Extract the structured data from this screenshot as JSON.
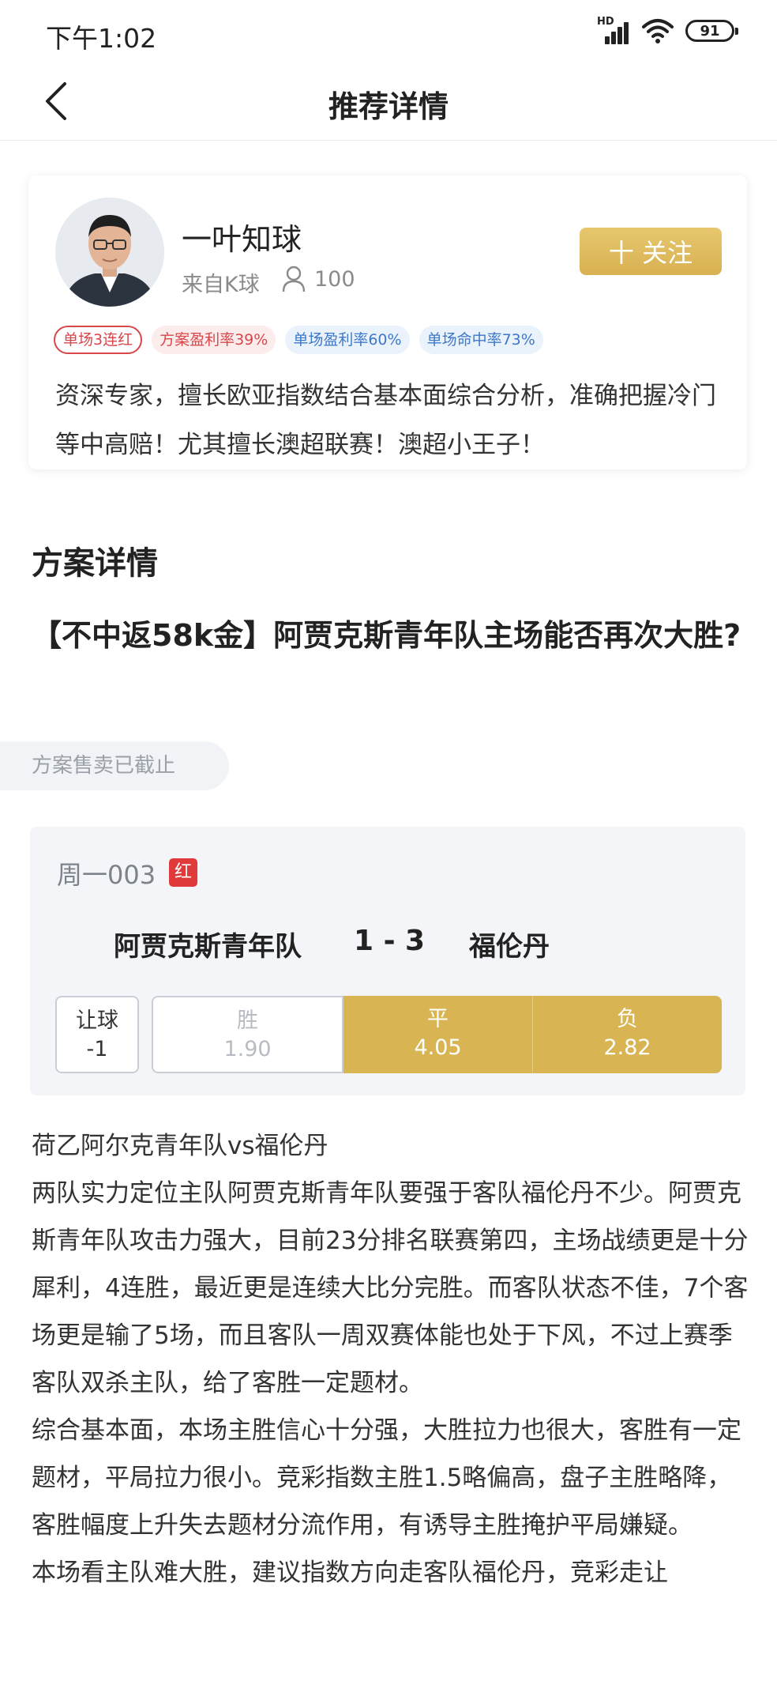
{
  "status_bar": {
    "time": "下午1:02",
    "signal_label": "HD",
    "battery": "91"
  },
  "nav": {
    "title": "推荐详情"
  },
  "expert": {
    "name": "一叶知球",
    "source": "来自K球",
    "fans": "100",
    "follow_label": "十 关注",
    "tags": [
      "单场3连红",
      "方案盈利率39%",
      "单场盈利率60%",
      "单场命中率73%"
    ],
    "description": "资深专家，擅长欧亚指数结合基本面综合分析，准确把握冷门等中高赔！尤其擅长澳超联赛！澳超小王子！"
  },
  "plan": {
    "section_title": "方案详情",
    "title": "【不中返58k金】阿贾克斯青年队主场能否再次大胜?",
    "sale_status": "方案售卖已截止"
  },
  "match": {
    "number": "周一003",
    "result_badge": "红",
    "home_team": "阿贾克斯青年队",
    "score": "1 - 3",
    "away_team": "福伦丹",
    "handicap_label": "让球",
    "handicap_value": "-1",
    "odds": [
      {
        "label": "胜",
        "value": "1.90",
        "selected": false
      },
      {
        "label": "平",
        "value": "4.05",
        "selected": true
      },
      {
        "label": "负",
        "value": "2.82",
        "selected": true
      }
    ]
  },
  "article": {
    "paragraphs": [
      "荷乙阿尔克青年队vs福伦丹",
      "两队实力定位主队阿贾克斯青年队要强于客队福伦丹不少。阿贾克斯青年队攻击力强大，目前23分排名联赛第四，主场战绩更是十分犀利，4连胜，最近更是连续大比分完胜。而客队状态不佳，7个客场更是输了5场，而且客队一周双赛体能也处于下风，不过上赛季客队双杀主队，给了客胜一定题材。",
      "综合基本面，本场主胜信心十分强，大胜拉力也很大，客胜有一定题材，平局拉力很小。竞彩指数主胜1.5略偏高，盘子主胜略降，客胜幅度上升失去题材分流作用，有诱导主胜掩护平局嫌疑。",
      "本场看主队难大胜，建议指数方向走客队福伦丹，竞彩走让"
    ]
  }
}
